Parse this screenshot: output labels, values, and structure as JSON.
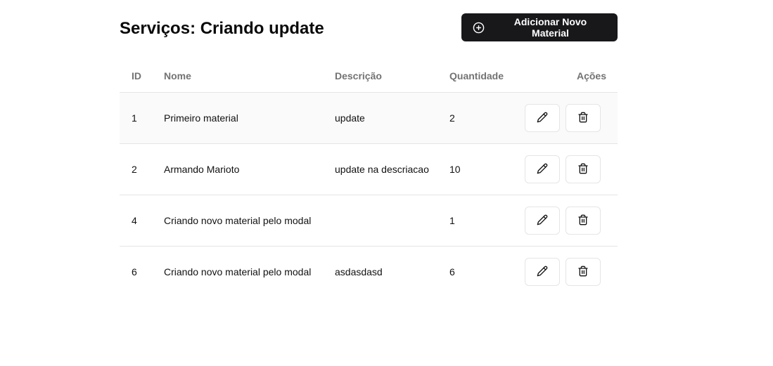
{
  "header": {
    "title": "Serviços: Criando update",
    "add_button_label": "Adicionar Novo Material",
    "add_button_icon": "plus-circle-icon"
  },
  "table": {
    "columns": [
      "ID",
      "Nome",
      "Descrição",
      "Quantidade",
      "Ações"
    ],
    "rows": [
      {
        "id": "1",
        "nome": "Primeiro material",
        "descricao": "update",
        "quantidade": "2"
      },
      {
        "id": "2",
        "nome": "Armando Marioto",
        "descricao": "update na descriacao",
        "quantidade": "10"
      },
      {
        "id": "4",
        "nome": "Criando novo material pelo modal",
        "descricao": "",
        "quantidade": "1"
      },
      {
        "id": "6",
        "nome": "Criando novo material pelo modal",
        "descricao": "asdasdasd",
        "quantidade": "6"
      }
    ],
    "row_actions": [
      "pencil-icon",
      "trash-icon"
    ]
  },
  "colors": {
    "primary_button": "#18181b",
    "border": "#e5e5e5",
    "header_text": "#737373",
    "hover_row": "#fafafa"
  }
}
